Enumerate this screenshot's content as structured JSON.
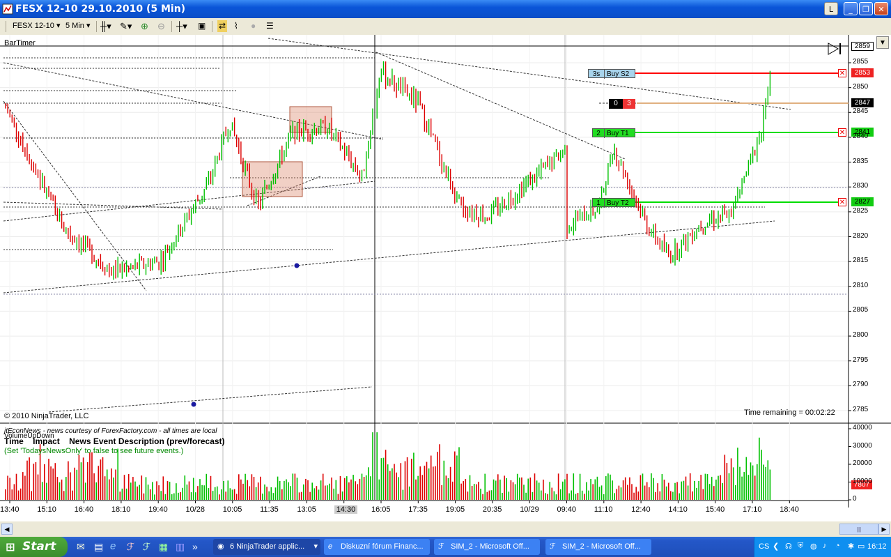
{
  "window": {
    "title": "FESX 12-10  29.10.2010 (5 Min)",
    "buttons": [
      "L",
      "_",
      "❐",
      "✕"
    ]
  },
  "toolbar": {
    "instrument": "FESX 12-10",
    "interval": "5 Min"
  },
  "chart": {
    "indicator_label": "BarTimer",
    "copyright": "© 2010 NinjaTrader, LLC",
    "time_remaining": "Time remaining = 00:02:22",
    "news": {
      "line1": "jtEconNews - news courtesy of ForexFactory.com - all times are local",
      "line2_label": "VolumeUpDown",
      "header": "Time    Impact    News Event Description (prev/forecast)",
      "hint": "(Set 'TodaysNewsOnly' to false to see future events.)"
    },
    "price_axis": [
      "2855",
      "2850",
      "2845",
      "2840",
      "2835",
      "2830",
      "2825",
      "2820",
      "2815",
      "2810",
      "2805",
      "2800",
      "2795",
      "2790",
      "2785"
    ],
    "price_markers": {
      "last": "2859",
      "buy_s2": "2853",
      "current": "2847",
      "buy_t1": "2841",
      "buy_t2": "2827"
    },
    "volume_axis": [
      "40000",
      "30000",
      "20000",
      "10000",
      "0"
    ],
    "volume_last": "7807",
    "time_axis": [
      "13:40",
      "15:10",
      "16:40",
      "18:10",
      "19:40",
      "10/28",
      "10:05",
      "11:35",
      "13:05",
      "14:30",
      "16:05",
      "17:35",
      "19:05",
      "20:35",
      "10/29",
      "09:40",
      "11:10",
      "12:40",
      "14:10",
      "15:40",
      "17:10",
      "18:40"
    ],
    "orders": [
      {
        "qty": "3s",
        "label": "Buy S2",
        "color": "#a8d4ec"
      },
      {
        "qty": "2",
        "label": "Buy T1",
        "color": "#22dd22"
      },
      {
        "qty": "1",
        "label": "Buy T2",
        "color": "#22dd22"
      }
    ],
    "position": {
      "left": "0",
      "right": "3"
    }
  },
  "taskbar": {
    "start": "Start",
    "tasks": [
      "6 NinjaTrader applic...",
      "Diskuzní fórum Financ...",
      "SIM_2 - Microsoft Off...",
      "SIM_2 - Microsoft Off..."
    ],
    "lang": "CS",
    "clock": "16:12"
  },
  "colors": {
    "up": "#00c000",
    "down": "#dd0000",
    "sell_line": "#ff0000",
    "buy_line": "#00dd00"
  }
}
